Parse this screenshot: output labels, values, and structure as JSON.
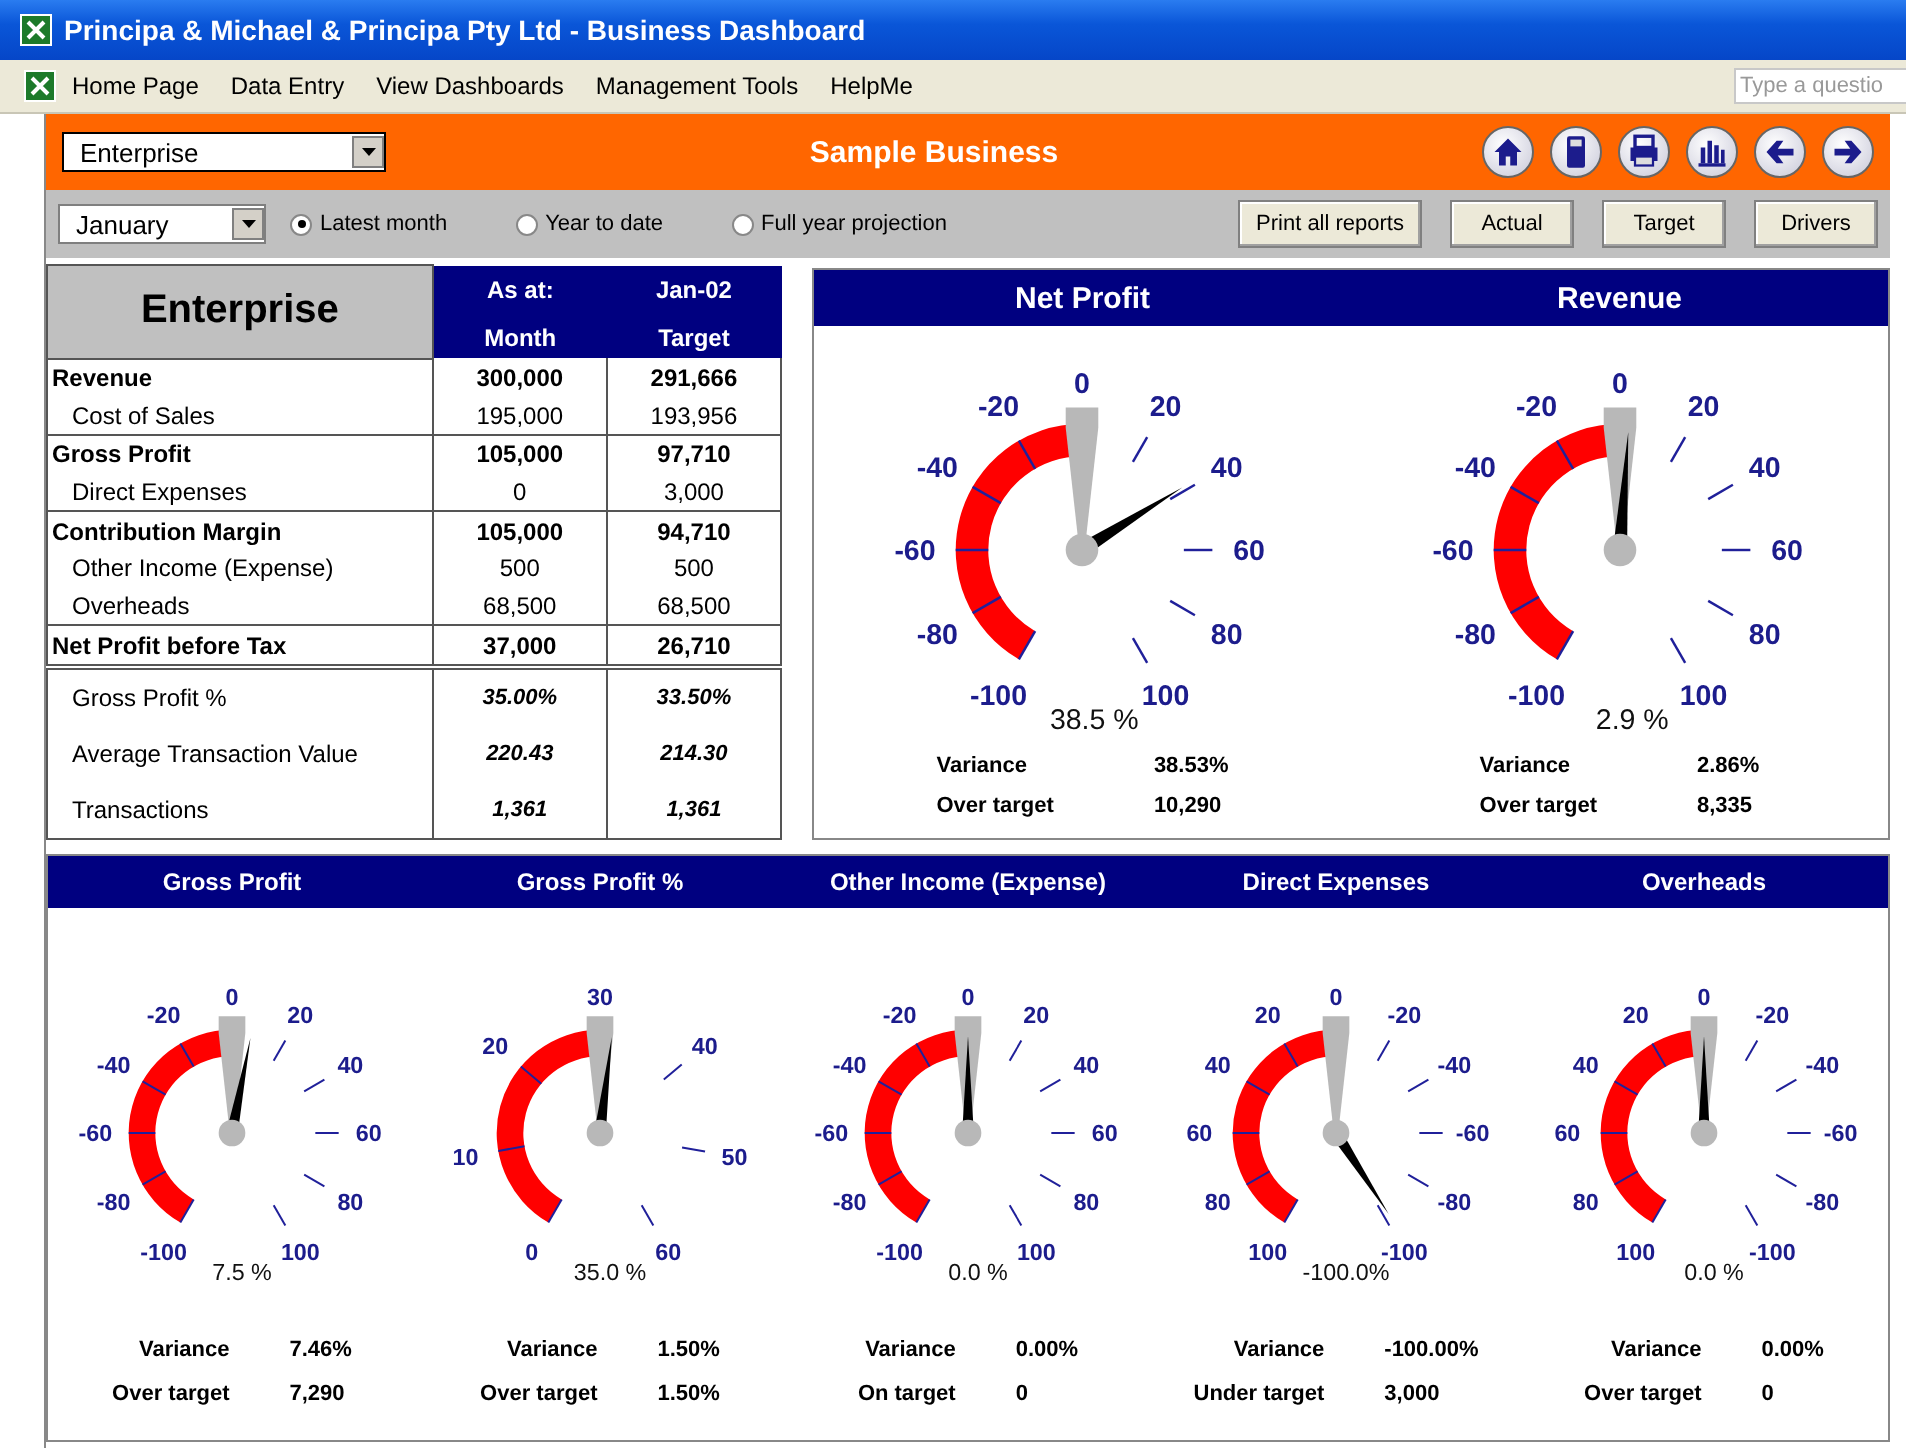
{
  "window": {
    "title": "Principa & Michael & Principa Pty Ltd - Business Dashboard"
  },
  "menu": [
    "Home Page",
    "Data Entry",
    "View Dashboards",
    "Management Tools",
    "HelpMe"
  ],
  "question_box": {
    "placeholder": "Type a questio"
  },
  "header": {
    "entity": "Enterprise",
    "title": "Sample Business"
  },
  "toolbar": {
    "month": "January",
    "periods": [
      {
        "label": "Latest month",
        "selected": true
      },
      {
        "label": "Year to date",
        "selected": false
      },
      {
        "label": "Full year projection",
        "selected": false
      }
    ],
    "buttons": [
      "Print all reports",
      "Actual",
      "Target",
      "Drivers"
    ]
  },
  "summary": {
    "title": "Enterprise",
    "as_at_label": "As at:",
    "as_at": "Jan-02",
    "columns": [
      "Month",
      "Target"
    ],
    "rows": [
      {
        "kind": "total",
        "label": "Revenue",
        "month": "300,000",
        "target": "291,666"
      },
      {
        "kind": "item",
        "label": "Cost of Sales",
        "month": "195,000",
        "target": "193,956"
      },
      {
        "kind": "total",
        "label": "Gross Profit",
        "month": "105,000",
        "target": "97,710"
      },
      {
        "kind": "item",
        "label": "Direct Expenses",
        "month": "0",
        "target": "3,000"
      },
      {
        "kind": "total",
        "label": "Contribution Margin",
        "month": "105,000",
        "target": "94,710"
      },
      {
        "kind": "item",
        "label": "Other Income (Expense)",
        "month": "500",
        "target": "500"
      },
      {
        "kind": "item",
        "label": "Overheads",
        "month": "68,500",
        "target": "68,500"
      },
      {
        "kind": "total",
        "label": "Net Profit before Tax",
        "month": "37,000",
        "target": "26,710"
      },
      {
        "kind": "ratio",
        "label": "Gross Profit %",
        "month": "35.00%",
        "target": "33.50%"
      },
      {
        "kind": "ratio",
        "label": "Average Transaction Value",
        "month": "220.43",
        "target": "214.30"
      },
      {
        "kind": "ratio",
        "label": "Transactions",
        "month": "1,361",
        "target": "1,361"
      }
    ]
  },
  "top_gauges": [
    {
      "title": "Net Profit",
      "left_labels": [
        "-100",
        "-80",
        "-60",
        "-40",
        "-20"
      ],
      "top_label": "0",
      "right_labels": [
        "20",
        "40",
        "60",
        "80",
        "100"
      ],
      "reading": "38.5 %",
      "stats": [
        {
          "label": "Variance",
          "value": "38.53%"
        },
        {
          "label": "Over target",
          "value": "10,290"
        }
      ]
    },
    {
      "title": "Revenue",
      "left_labels": [
        "-100",
        "-80",
        "-60",
        "-40",
        "-20"
      ],
      "top_label": "0",
      "right_labels": [
        "20",
        "40",
        "60",
        "80",
        "100"
      ],
      "reading": "2.9 %",
      "stats": [
        {
          "label": "Variance",
          "value": "2.86%"
        },
        {
          "label": "Over target",
          "value": "8,335"
        }
      ]
    }
  ],
  "bottom_gauges": [
    {
      "title": "Gross Profit",
      "left_labels": [
        "-100",
        "-80",
        "-60",
        "-40",
        "-20"
      ],
      "top_label": "0",
      "right_labels": [
        "20",
        "40",
        "60",
        "80",
        "100"
      ],
      "reading": "7.5 %",
      "stats": [
        {
          "label": "Variance",
          "value": "7.46%"
        },
        {
          "label": "Over target",
          "value": "7,290"
        }
      ]
    },
    {
      "title": "Gross Profit %",
      "left_labels": [
        "0",
        "10",
        "20"
      ],
      "top_label": "30",
      "right_labels": [
        "40",
        "50",
        "60"
      ],
      "reading": "35.0 %",
      "stats": [
        {
          "label": "Variance",
          "value": "1.50%"
        },
        {
          "label": "Over target",
          "value": "1.50%"
        }
      ]
    },
    {
      "title": "Other Income (Expense)",
      "left_labels": [
        "-100",
        "-80",
        "-60",
        "-40",
        "-20"
      ],
      "top_label": "0",
      "right_labels": [
        "20",
        "40",
        "60",
        "80",
        "100"
      ],
      "reading": "0.0 %",
      "stats": [
        {
          "label": "Variance",
          "value": "0.00%"
        },
        {
          "label": "On target",
          "value": "0"
        }
      ]
    },
    {
      "title": "Direct Expenses",
      "left_labels": [
        "100",
        "80",
        "60",
        "40",
        "20"
      ],
      "top_label": "0",
      "right_labels": [
        "-20",
        "-40",
        "-60",
        "-80",
        "-100"
      ],
      "reading": "-100.0%",
      "stats": [
        {
          "label": "Variance",
          "value": "-100.00%"
        },
        {
          "label": "Under target",
          "value": "3,000"
        }
      ]
    },
    {
      "title": "Overheads",
      "left_labels": [
        "100",
        "80",
        "60",
        "40",
        "20"
      ],
      "top_label": "0",
      "right_labels": [
        "-20",
        "-40",
        "-60",
        "-80",
        "-100"
      ],
      "reading": "0.0 %",
      "stats": [
        {
          "label": "Variance",
          "value": "0.00%"
        },
        {
          "label": "Over target",
          "value": "0"
        }
      ]
    }
  ]
}
